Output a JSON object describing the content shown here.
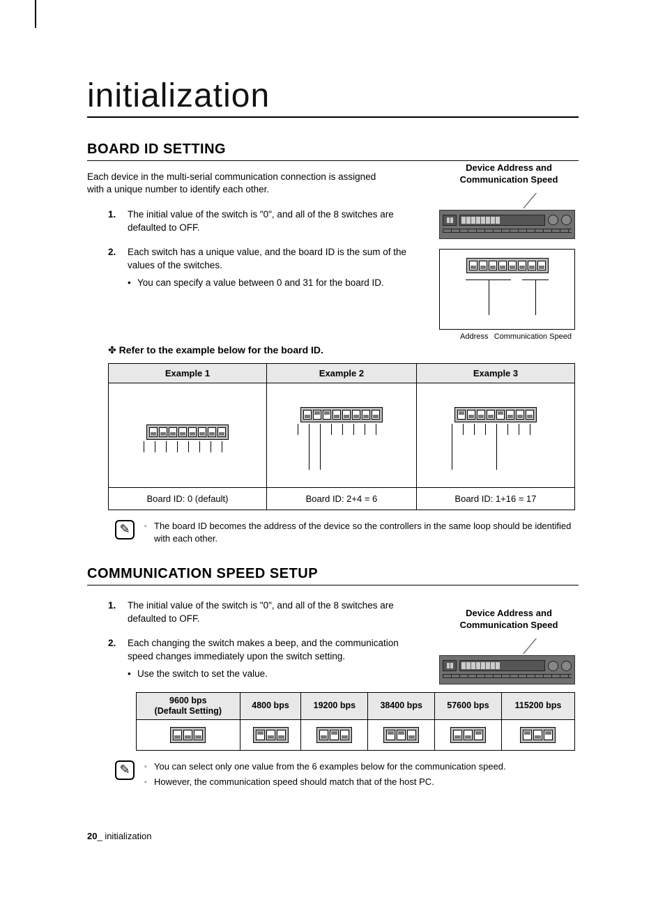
{
  "chapter_title": "initialization",
  "board_id": {
    "heading": "BOARD ID SETTING",
    "intro": "Each device in the multi-serial communication connection is assigned with a unique number to identify each other.",
    "figure_label_line1": "Device Address and",
    "figure_label_line2": "Communication Speed",
    "label_address": "Address",
    "label_comm_speed": "Communication Speed",
    "steps": [
      "The initial value of the switch is \"0\", and all of the 8 switches are defaulted to OFF.",
      "Each switch has a unique value, and the board ID is the sum of the values of the switches."
    ],
    "step2_bullet": "You can specify a value between 0 and 31 for the board ID.",
    "example_subhead": "Refer to the example below for the board ID.",
    "examples": {
      "headers": [
        "Example 1",
        "Example 2",
        "Example 3"
      ],
      "switches": [
        [
          0,
          0,
          0,
          0,
          0,
          0,
          0,
          0
        ],
        [
          0,
          1,
          1,
          0,
          0,
          0,
          0,
          0
        ],
        [
          1,
          0,
          0,
          0,
          1,
          0,
          0,
          0
        ]
      ],
      "labels": [
        "Board ID: 0 (default)",
        "Board ID: 2+4 = 6",
        "Board ID: 1+16 = 17"
      ]
    },
    "note": "The board ID becomes the address of the device so the controllers in the same loop should be identified with each other."
  },
  "comm_speed": {
    "heading": "COMMUNICATION SPEED SETUP",
    "figure_label_line1": "Device Address and",
    "figure_label_line2": "Communication Speed",
    "steps": [
      "The initial value of the switch is \"0\", and all of the 8 switches are defaulted to OFF.",
      "Each changing the switch makes a beep, and the communication speed changes immediately upon the switch setting."
    ],
    "step2_bullet": "Use the switch to set the value.",
    "table": {
      "headers": [
        "9600 bps\n(Default Setting)",
        "4800 bps",
        "19200 bps",
        "38400 bps",
        "57600 bps",
        "115200 bps"
      ],
      "switches": [
        [
          0,
          0,
          0
        ],
        [
          1,
          0,
          0
        ],
        [
          0,
          1,
          0
        ],
        [
          1,
          1,
          0
        ],
        [
          0,
          0,
          1
        ],
        [
          1,
          0,
          1
        ]
      ]
    },
    "notes": [
      "You can select only one value from the 6 examples below for the communication speed.",
      "However, the communication speed should match that of the host PC."
    ]
  },
  "footer": {
    "page": "20",
    "sep": "_ ",
    "title": "initialization"
  }
}
